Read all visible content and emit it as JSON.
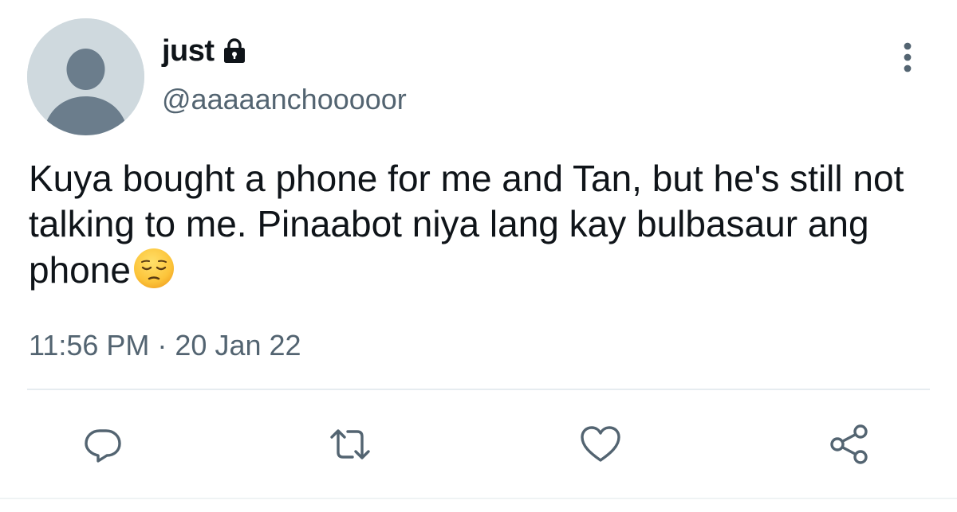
{
  "tweet": {
    "display_name": "just",
    "handle": "@aaaaanchooooor",
    "text": "Kuya bought a phone for me and Tan, but he's still not talking to me. Pinaabot niya lang kay bulbasaur ang phone",
    "emoji": "pensive-face",
    "timestamp": "11:56 PM · 20 Jan 22",
    "protected_icon": "lock-icon"
  },
  "actions": [
    {
      "name": "reply",
      "icon": "reply-icon"
    },
    {
      "name": "retweet",
      "icon": "retweet-icon"
    },
    {
      "name": "like",
      "icon": "heart-icon"
    },
    {
      "name": "share",
      "icon": "share-icon"
    }
  ],
  "colors": {
    "text_primary": "#0f1419",
    "text_secondary": "#536471",
    "icon": "#536471",
    "avatar_bg": "#cfd9de",
    "avatar_fg": "#6b7d8c",
    "divider": "#e6ecf0"
  }
}
